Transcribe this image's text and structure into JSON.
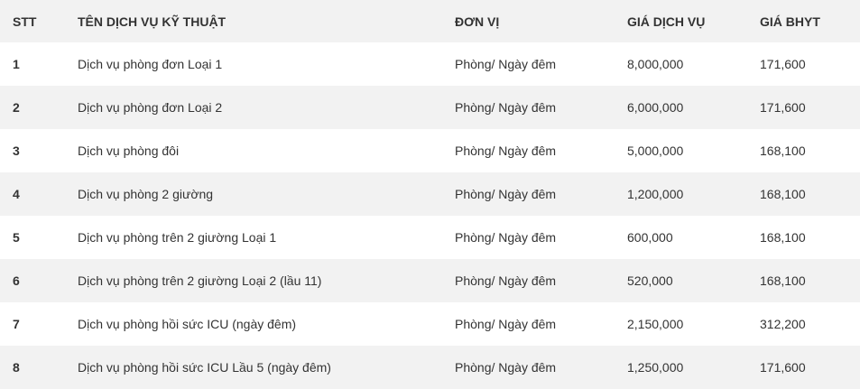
{
  "table": {
    "headers": {
      "stt": "STT",
      "service": "TÊN DỊCH VỤ KỸ THUẬT",
      "unit": "ĐƠN VỊ",
      "service_price": "GIÁ DỊCH VỤ",
      "insurance_price": "GIÁ BHYT"
    },
    "rows": [
      {
        "stt": "1",
        "service": "Dịch vụ phòng đơn Loại 1",
        "unit": "Phòng/ Ngày đêm",
        "service_price": "8,000,000",
        "insurance_price": "171,600"
      },
      {
        "stt": "2",
        "service": "Dịch vụ phòng đơn Loại 2",
        "unit": "Phòng/ Ngày đêm",
        "service_price": "6,000,000",
        "insurance_price": "171,600"
      },
      {
        "stt": "3",
        "service": "Dịch vụ phòng đôi",
        "unit": "Phòng/ Ngày đêm",
        "service_price": "5,000,000",
        "insurance_price": "168,100"
      },
      {
        "stt": "4",
        "service": "Dịch vụ phòng 2 giường",
        "unit": "Phòng/ Ngày đêm",
        "service_price": "1,200,000",
        "insurance_price": "168,100"
      },
      {
        "stt": "5",
        "service": "Dịch vụ phòng trên 2 giường Loại 1",
        "unit": "Phòng/ Ngày đêm",
        "service_price": "600,000",
        "insurance_price": "168,100"
      },
      {
        "stt": "6",
        "service": "Dịch vụ phòng trên 2 giường Loại 2 (lầu 11)",
        "unit": "Phòng/ Ngày đêm",
        "service_price": "520,000",
        "insurance_price": "168,100"
      },
      {
        "stt": "7",
        "service": "Dịch vụ phòng hồi sức ICU (ngày đêm)",
        "unit": "Phòng/ Ngày đêm",
        "service_price": "2,150,000",
        "insurance_price": "312,200"
      },
      {
        "stt": "8",
        "service": "Dịch vụ phòng hồi sức ICU Lầu 5 (ngày đêm)",
        "unit": "Phòng/ Ngày đêm",
        "service_price": "1,250,000",
        "insurance_price": "171,600"
      }
    ]
  }
}
